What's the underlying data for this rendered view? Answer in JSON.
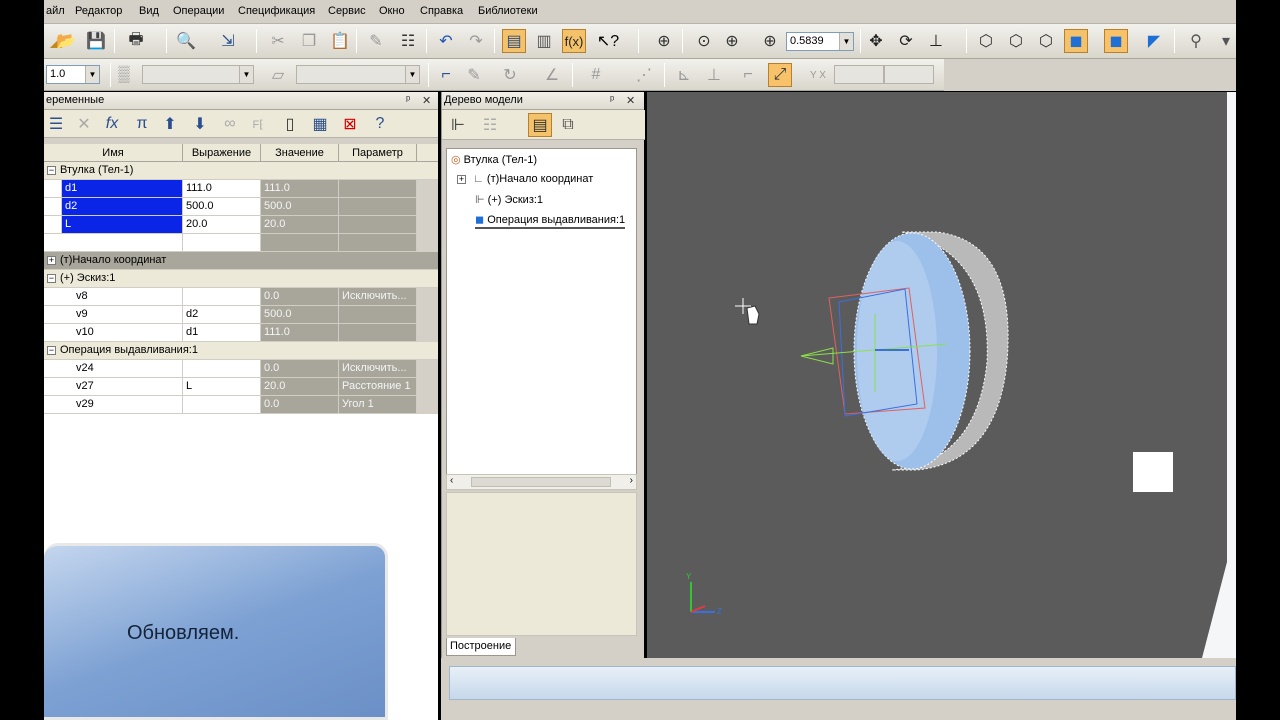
{
  "menu": [
    "айл",
    "Редактор",
    "Вид",
    "Операции",
    "Спецификация",
    "Сервис",
    "Окно",
    "Справка",
    "Библиотеки"
  ],
  "toolbar": {
    "zoom_value": "0.5839",
    "line_scale": "1.0"
  },
  "variables_panel": {
    "title": "еременные",
    "pin": "ᵖ",
    "close": "✕",
    "columns": [
      "Имя",
      "Выражение",
      "Значение",
      "Параметр"
    ],
    "root": "Втулка (Тел-1)",
    "rows_main": [
      {
        "name": "d1",
        "expr": "111.0",
        "value": "111.0",
        "param": ""
      },
      {
        "name": "d2",
        "expr": "500.0",
        "value": "500.0",
        "param": ""
      },
      {
        "name": "L",
        "expr": "20.0",
        "value": "20.0",
        "param": ""
      }
    ],
    "group_origin": "(т)Начало координат",
    "group_sketch": "(+) Эскиз:1",
    "rows_sketch": [
      {
        "name": "v8",
        "expr": "",
        "value": "0.0",
        "param": "Исключить..."
      },
      {
        "name": "v9",
        "expr": "d2",
        "value": "500.0",
        "param": ""
      },
      {
        "name": "v10",
        "expr": "d1",
        "value": "111.0",
        "param": ""
      }
    ],
    "group_extrude": "Операция выдавливания:1",
    "rows_extrude": [
      {
        "name": "v24",
        "expr": "",
        "value": "0.0",
        "param": "Исключить..."
      },
      {
        "name": "v27",
        "expr": "L",
        "value": "20.0",
        "param": "Расстояние 1"
      },
      {
        "name": "v29",
        "expr": "",
        "value": "0.0",
        "param": "Угол 1"
      }
    ]
  },
  "hint": "Обновляем.",
  "tree_panel": {
    "title": "Дерево модели",
    "pin": "ᵖ",
    "close": "✕",
    "items": [
      "Втулка (Тел-1)",
      "(т)Начало координат",
      "(+) Эскиз:1",
      "Операция выдавливания:1"
    ],
    "tab": "Построение"
  },
  "colors": {
    "selection": "#0a25e6",
    "viewport_bg": "#5b5b5b",
    "highlight_tool": "#f7c26a"
  }
}
